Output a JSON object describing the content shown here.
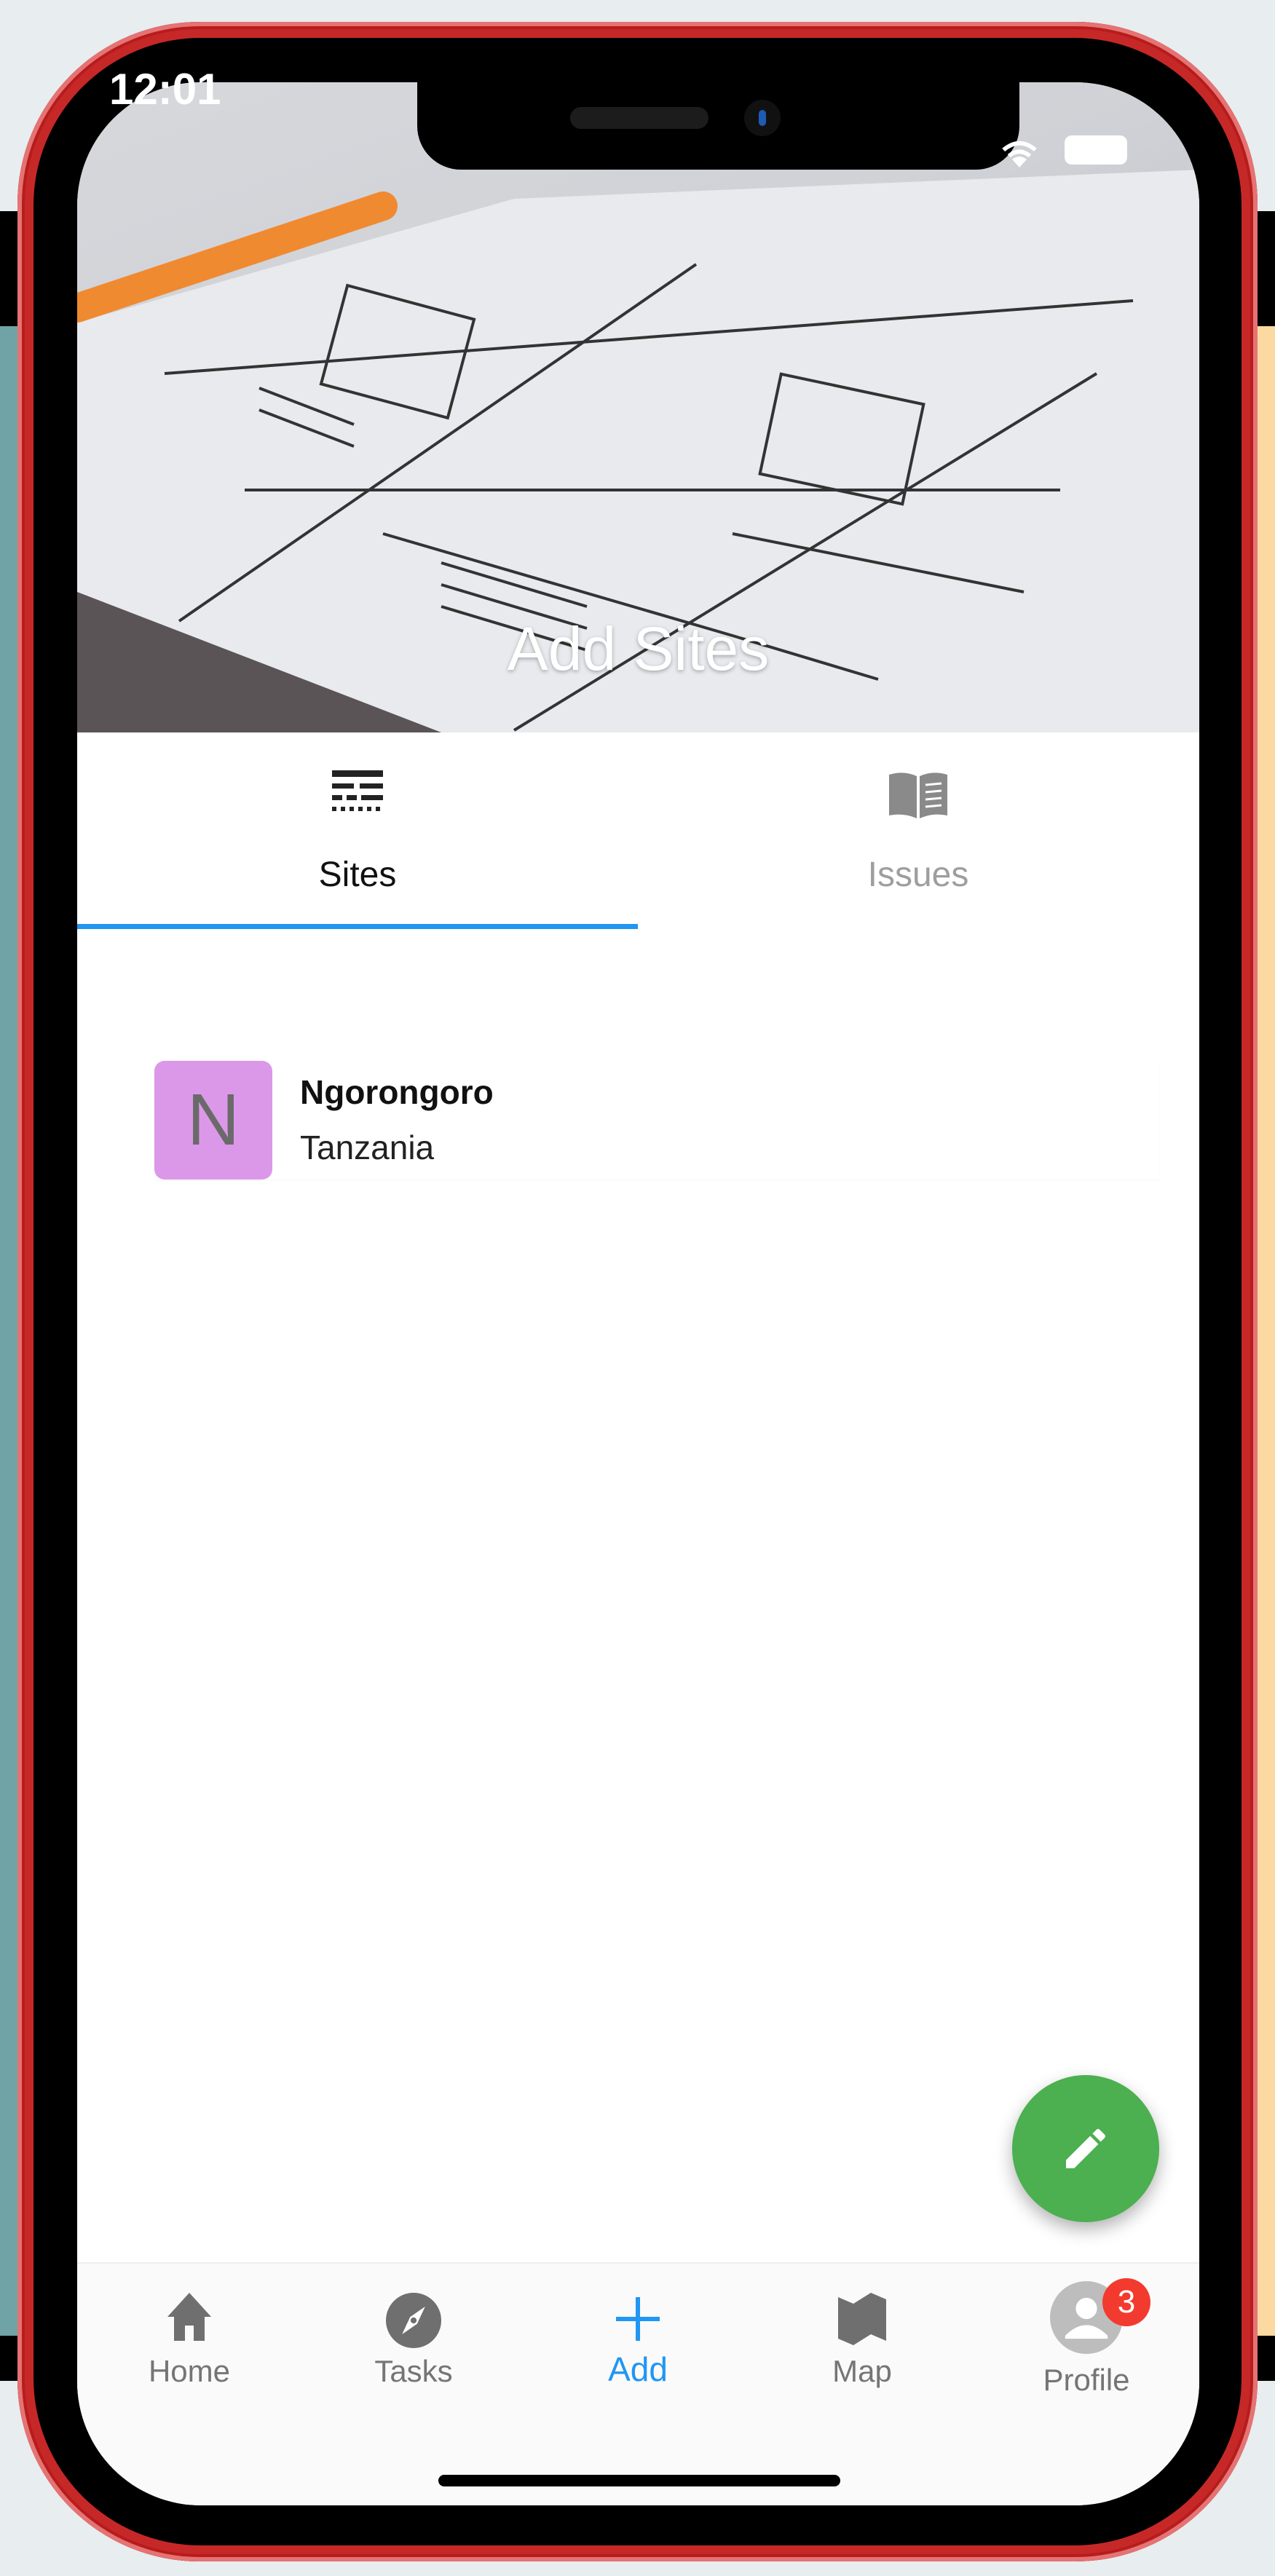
{
  "status_bar": {
    "time": "12:01"
  },
  "header": {
    "title": "Add Sites"
  },
  "tabs": [
    {
      "label": "Sites",
      "icon": "sites-lines-icon",
      "selected": true
    },
    {
      "label": "Issues",
      "icon": "book-icon",
      "selected": false
    }
  ],
  "sites": [
    {
      "initial": "N",
      "name": "Ngorongoro",
      "country": "Tanzania",
      "avatar_color": "#dc98e8"
    }
  ],
  "fab": {
    "icon": "pencil-icon",
    "color": "#4caf50"
  },
  "bottom_nav": {
    "items": [
      {
        "label": "Home",
        "icon": "home-icon",
        "active": false
      },
      {
        "label": "Tasks",
        "icon": "compass-icon",
        "active": false
      },
      {
        "label": "Add",
        "icon": "plus-icon",
        "active": true
      },
      {
        "label": "Map",
        "icon": "map-icon",
        "active": false
      },
      {
        "label": "Profile",
        "icon": "profile-icon",
        "active": false,
        "badge": "3"
      }
    ]
  },
  "colors": {
    "accent": "#2196f3",
    "frame": "#c62828",
    "badge": "#f33a2e"
  }
}
